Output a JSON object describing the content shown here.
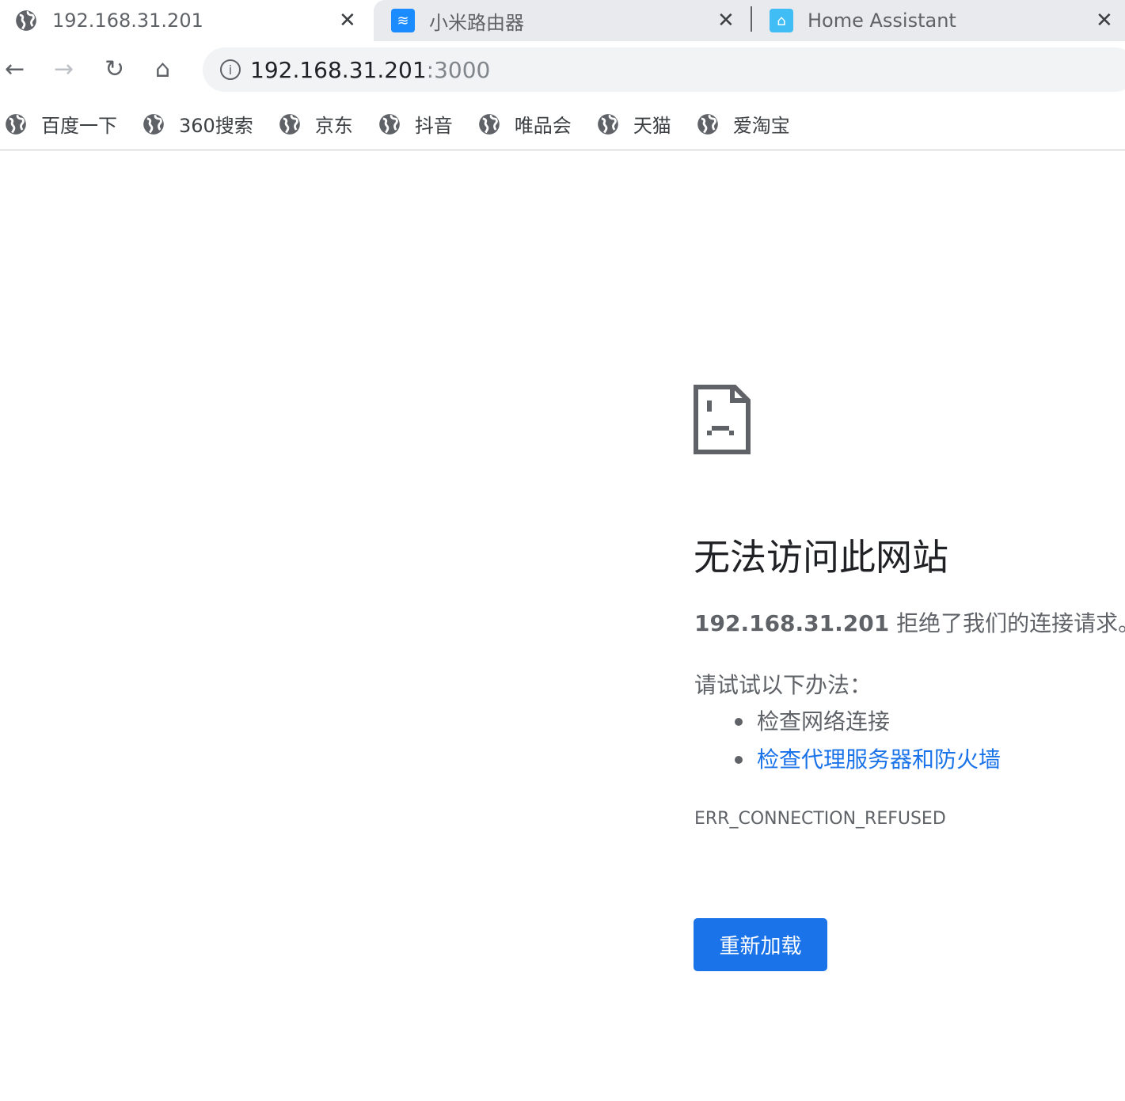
{
  "tabs": [
    {
      "title": "192.168.31.201",
      "icon": "globe-icon",
      "active": true
    },
    {
      "title": "小米路由器",
      "icon": "wifi-icon",
      "active": false
    },
    {
      "title": "Home Assistant",
      "icon": "home-assistant-icon",
      "active": false
    }
  ],
  "address": {
    "host": "192.168.31.201",
    "port": ":3000"
  },
  "bookmarks": [
    {
      "label": "百度一下"
    },
    {
      "label": "360搜索"
    },
    {
      "label": "京东"
    },
    {
      "label": "抖音"
    },
    {
      "label": "唯品会"
    },
    {
      "label": "天猫"
    },
    {
      "label": "爱淘宝"
    }
  ],
  "error": {
    "title": "无法访问此网站",
    "host": "192.168.31.201",
    "message": "拒绝了我们的连接请求。",
    "try_label": "请试试以下办法：",
    "suggestions": [
      "检查网络连接",
      "检查代理服务器和防火墙"
    ],
    "code": "ERR_CONNECTION_REFUSED",
    "reload_label": "重新加载"
  },
  "colors": {
    "accent": "#1a73e8",
    "text": "#5f6368"
  }
}
